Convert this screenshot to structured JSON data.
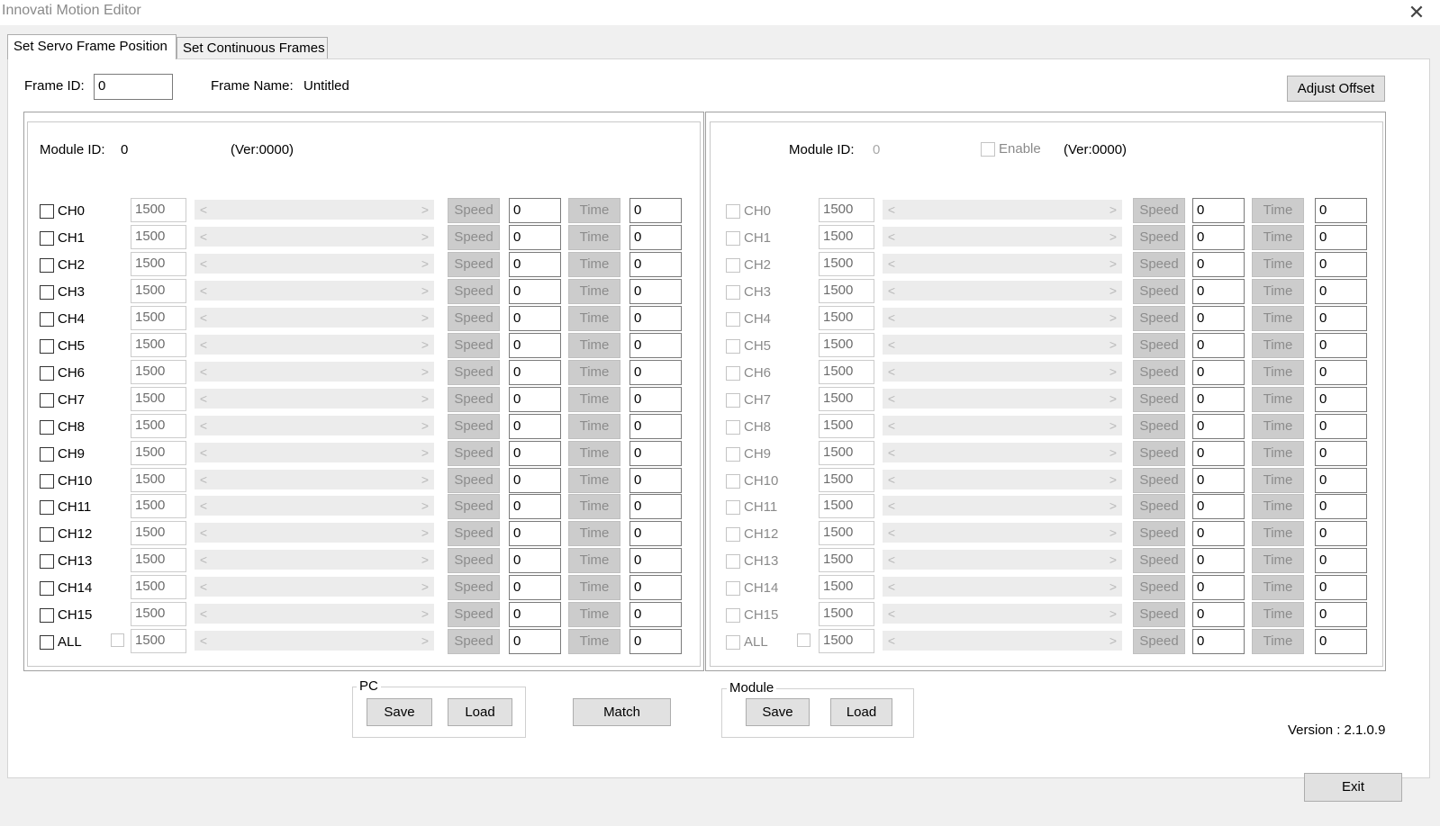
{
  "window": {
    "title": "Innovati Motion Editor",
    "close_glyph": "✕"
  },
  "tabs": [
    {
      "label": "Set Servo Frame Position",
      "active": true
    },
    {
      "label": "Set Continuous Frames",
      "active": false
    }
  ],
  "frame": {
    "id_label": "Frame ID:",
    "id_value": "0",
    "name_label": "Frame Name:",
    "name_value": "Untitled"
  },
  "adjust_offset_label": "Adjust Offset",
  "left_module": {
    "module_id_label": "Module ID:",
    "module_id_value": "0",
    "version": "(Ver:0000)",
    "enabled": true,
    "channels": [
      {
        "label": "CH0",
        "value": "1500",
        "speed": "0",
        "time": "0"
      },
      {
        "label": "CH1",
        "value": "1500",
        "speed": "0",
        "time": "0"
      },
      {
        "label": "CH2",
        "value": "1500",
        "speed": "0",
        "time": "0"
      },
      {
        "label": "CH3",
        "value": "1500",
        "speed": "0",
        "time": "0"
      },
      {
        "label": "CH4",
        "value": "1500",
        "speed": "0",
        "time": "0"
      },
      {
        "label": "CH5",
        "value": "1500",
        "speed": "0",
        "time": "0"
      },
      {
        "label": "CH6",
        "value": "1500",
        "speed": "0",
        "time": "0"
      },
      {
        "label": "CH7",
        "value": "1500",
        "speed": "0",
        "time": "0"
      },
      {
        "label": "CH8",
        "value": "1500",
        "speed": "0",
        "time": "0"
      },
      {
        "label": "CH9",
        "value": "1500",
        "speed": "0",
        "time": "0"
      },
      {
        "label": "CH10",
        "value": "1500",
        "speed": "0",
        "time": "0"
      },
      {
        "label": "CH11",
        "value": "1500",
        "speed": "0",
        "time": "0"
      },
      {
        "label": "CH12",
        "value": "1500",
        "speed": "0",
        "time": "0"
      },
      {
        "label": "CH13",
        "value": "1500",
        "speed": "0",
        "time": "0"
      },
      {
        "label": "CH14",
        "value": "1500",
        "speed": "0",
        "time": "0"
      },
      {
        "label": "CH15",
        "value": "1500",
        "speed": "0",
        "time": "0"
      },
      {
        "label": "ALL",
        "value": "1500",
        "speed": "0",
        "time": "0",
        "extra_checkbox": true
      }
    ]
  },
  "right_module": {
    "module_id_label": "Module ID:",
    "module_id_value": "0",
    "version": "(Ver:0000)",
    "enable_label": "Enable",
    "enabled": false,
    "channels": [
      {
        "label": "CH0",
        "value": "1500",
        "speed": "0",
        "time": "0"
      },
      {
        "label": "CH1",
        "value": "1500",
        "speed": "0",
        "time": "0"
      },
      {
        "label": "CH2",
        "value": "1500",
        "speed": "0",
        "time": "0"
      },
      {
        "label": "CH3",
        "value": "1500",
        "speed": "0",
        "time": "0"
      },
      {
        "label": "CH4",
        "value": "1500",
        "speed": "0",
        "time": "0"
      },
      {
        "label": "CH5",
        "value": "1500",
        "speed": "0",
        "time": "0"
      },
      {
        "label": "CH6",
        "value": "1500",
        "speed": "0",
        "time": "0"
      },
      {
        "label": "CH7",
        "value": "1500",
        "speed": "0",
        "time": "0"
      },
      {
        "label": "CH8",
        "value": "1500",
        "speed": "0",
        "time": "0"
      },
      {
        "label": "CH9",
        "value": "1500",
        "speed": "0",
        "time": "0"
      },
      {
        "label": "CH10",
        "value": "1500",
        "speed": "0",
        "time": "0"
      },
      {
        "label": "CH11",
        "value": "1500",
        "speed": "0",
        "time": "0"
      },
      {
        "label": "CH12",
        "value": "1500",
        "speed": "0",
        "time": "0"
      },
      {
        "label": "CH13",
        "value": "1500",
        "speed": "0",
        "time": "0"
      },
      {
        "label": "CH14",
        "value": "1500",
        "speed": "0",
        "time": "0"
      },
      {
        "label": "CH15",
        "value": "1500",
        "speed": "0",
        "time": "0"
      },
      {
        "label": "ALL",
        "value": "1500",
        "speed": "0",
        "time": "0",
        "extra_checkbox": true
      }
    ]
  },
  "row_labels": {
    "speed": "Speed",
    "time": "Time",
    "left_arrow": "<",
    "right_arrow": ">"
  },
  "pc_group": {
    "title": "PC",
    "save": "Save",
    "load": "Load"
  },
  "match_label": "Match",
  "module_group": {
    "title": "Module",
    "save": "Save",
    "load": "Load"
  },
  "version_text": "Version : 2.1.0.9",
  "exit_label": "Exit"
}
